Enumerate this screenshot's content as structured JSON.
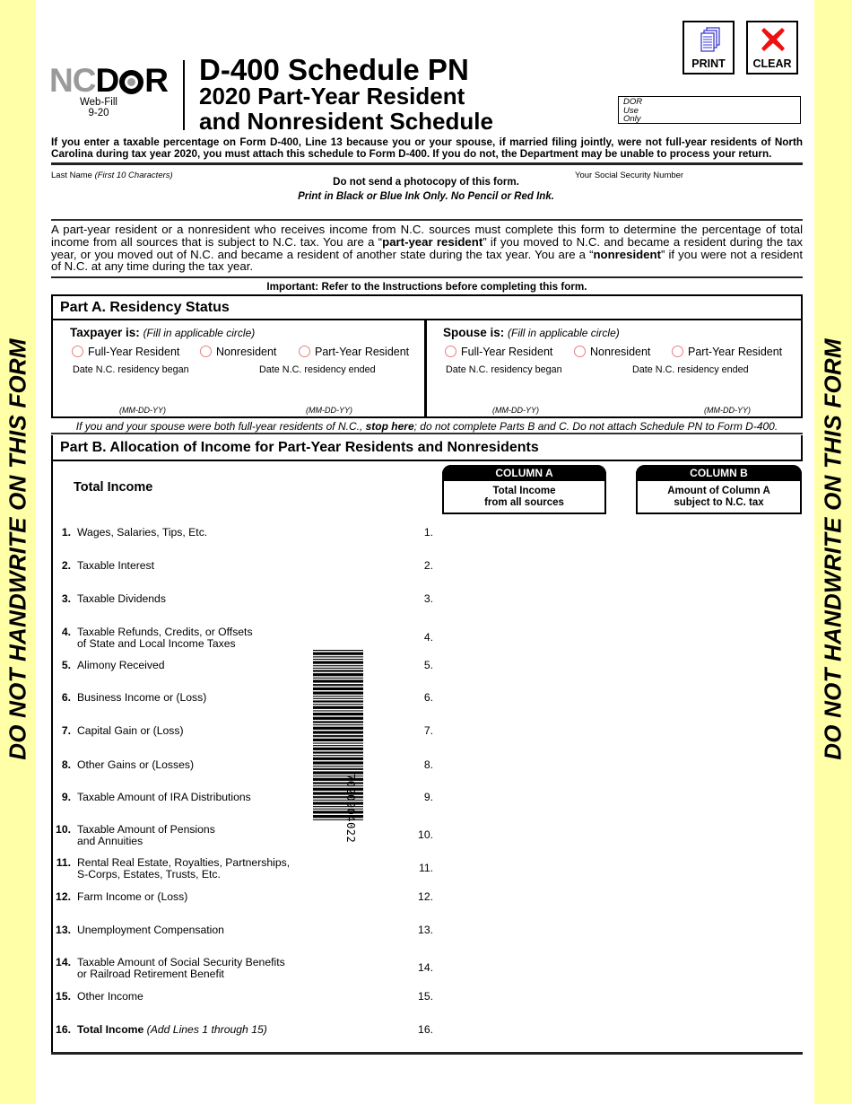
{
  "side_banner": {
    "text": "DO NOT HANDWRITE ON THIS FORM",
    "color": "#ffffa8"
  },
  "header": {
    "logo_nc": "NC",
    "logo_d": "D",
    "logo_r": "R",
    "web_fill": "Web-Fill",
    "version": "9-20",
    "title": "D-400 Schedule PN",
    "subtitle_line1": "2020 Part-Year Resident",
    "subtitle_line2": "and Nonresident Schedule"
  },
  "toolbar": {
    "print_label": "PRINT",
    "clear_label": "CLEAR",
    "print_icon_color": "#3a3ad6",
    "clear_icon_color": "#ee1111"
  },
  "dor_use_only": [
    "DOR",
    "Use",
    "Only"
  ],
  "notice": "If you enter a taxable percentage on Form D-400, Line 13 because you or your spouse, if married filing jointly, were not full-year residents of North Carolina during tax year 2020, you must attach this schedule to Form D-400.  If you do not, the Department may be unable to process your return.",
  "identity": {
    "last_name_label": "Last Name",
    "last_name_hint": "(First 10 Characters)",
    "ssn_label": "Your Social Security Number",
    "photocopy_note": "Do not send a photocopy of this form.",
    "ink_note": "Print in Black or Blue Ink Only.  No Pencil or Red Ink."
  },
  "intro": {
    "part1": "A part-year resident or a nonresident who receives income from N.C. sources must complete this form to determine the percentage of total income from all sources that is subject to N.C. tax.  You are a “",
    "bold1": "part-year resident",
    "part2": "” if you moved to N.C. and became a resident during the tax year, or you moved out of N.C. and became a resident of another state during the tax year.  You are a “",
    "bold2": "nonresident",
    "part3": "” if you were not a resident of N.C. at any time during the tax year."
  },
  "important": "Important:  Refer to the Instructions before completing this form.",
  "part_a": {
    "title": "Part A. Residency Status",
    "taxpayer": {
      "heading": "Taxpayer is:",
      "hint": "(Fill in applicable circle)",
      "options": [
        "Full-Year Resident",
        "Nonresident",
        "Part-Year Resident"
      ],
      "began_label": "Date N.C. residency began",
      "ended_label": "Date N.C. residency ended",
      "date_format": "(MM-DD-YY)"
    },
    "spouse": {
      "heading": "Spouse is:",
      "hint": "(Fill in applicable circle)",
      "options": [
        "Full-Year Resident",
        "Nonresident",
        "Part-Year Resident"
      ],
      "began_label": "Date N.C. residency began",
      "ended_label": "Date N.C. residency ended",
      "date_format": "(MM-DD-YY)"
    },
    "stop_note_pre": "If you and your spouse were both full-year residents of N.C., ",
    "stop_note_bold": "stop here",
    "stop_note_post": "; do not complete Parts B and C.  Do not attach Schedule PN to Form D-400."
  },
  "part_b": {
    "title": "Part B. Allocation of Income for Part-Year Residents and Nonresidents",
    "section_label": "Total Income",
    "column_a": {
      "header": "COLUMN A",
      "line1": "Total Income",
      "line2": "from all sources"
    },
    "column_b": {
      "header": "COLUMN B",
      "line1": "Amount of Column A",
      "line2": "subject to N.C. tax"
    },
    "lines": [
      {
        "num": "1.",
        "text": "Wages, Salaries, Tips, Etc.",
        "text2": "",
        "ref": "1."
      },
      {
        "num": "2.",
        "text": "Taxable Interest",
        "text2": "",
        "ref": "2."
      },
      {
        "num": "3.",
        "text": "Taxable Dividends",
        "text2": "",
        "ref": "3."
      },
      {
        "num": "4.",
        "text": "Taxable Refunds, Credits, or Offsets",
        "text2": "of State and Local Income Taxes",
        "ref": "4."
      },
      {
        "num": "5.",
        "text": "Alimony Received",
        "text2": "",
        "ref": "5."
      },
      {
        "num": "6.",
        "text": "Business Income or (Loss)",
        "text2": "",
        "ref": "6."
      },
      {
        "num": "7.",
        "text": "Capital Gain or (Loss)",
        "text2": "",
        "ref": "7."
      },
      {
        "num": "8.",
        "text": "Other Gains or (Losses)",
        "text2": "",
        "ref": "8."
      },
      {
        "num": "9.",
        "text": "Taxable Amount of IRA Distributions",
        "text2": "",
        "ref": "9."
      },
      {
        "num": "10.",
        "text": "Taxable Amount of Pensions",
        "text2": "and Annuities",
        "ref": "10."
      },
      {
        "num": "11.",
        "text": "Rental Real Estate, Royalties, Partnerships,",
        "text2": "S-Corps, Estates, Trusts, Etc.",
        "ref": "11."
      },
      {
        "num": "12.",
        "text": "Farm Income or (Loss)",
        "text2": "",
        "ref": "12."
      },
      {
        "num": "13.",
        "text": "Unemployment Compensation",
        "text2": "",
        "ref": "13."
      },
      {
        "num": "14.",
        "text": "Taxable Amount of Social Security Benefits",
        "text2": "or Railroad Retirement Benefit",
        "ref": "14."
      },
      {
        "num": "15.",
        "text": "Other Income",
        "text2": "",
        "ref": "15."
      },
      {
        "num": "16.",
        "text": "Total Income",
        "text_italic": "(Add Lines 1 through 15)",
        "text2": "",
        "ref": "16."
      }
    ]
  },
  "barcode": {
    "number": "7020904022"
  }
}
